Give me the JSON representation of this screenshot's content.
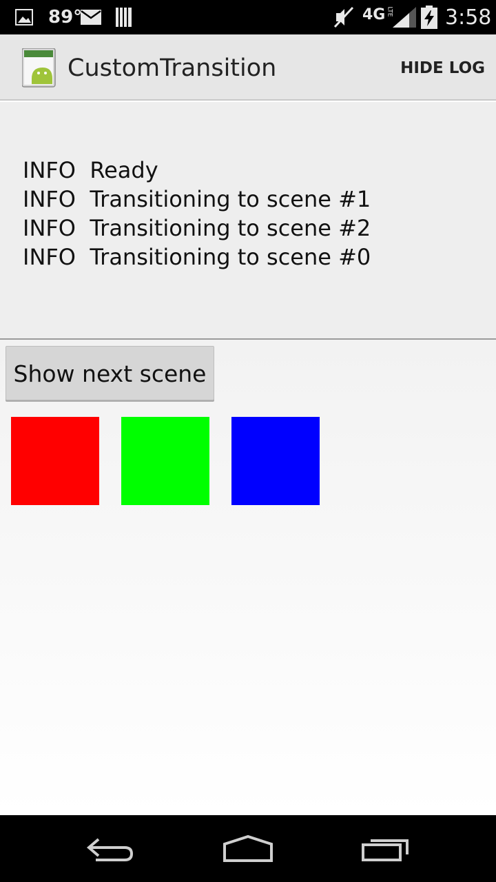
{
  "status_bar": {
    "temperature": "89°",
    "network": "4G",
    "network_sub": "LTE",
    "time": "3:58",
    "icons": [
      "image-icon",
      "mail-icon",
      "barcode-icon",
      "mute-icon",
      "signal-icon",
      "battery-charging-icon"
    ]
  },
  "action_bar": {
    "title": "CustomTransition",
    "hide_log_label": "HIDE LOG",
    "icon": "android-app-icon"
  },
  "log": {
    "entries": [
      {
        "level": "INFO",
        "message": "Ready"
      },
      {
        "level": "INFO",
        "message": "Transitioning to scene #1"
      },
      {
        "level": "INFO",
        "message": "Transitioning to scene #2"
      },
      {
        "level": "INFO",
        "message": "Transitioning to scene #0"
      }
    ]
  },
  "content": {
    "next_scene_label": "Show next scene",
    "squares": [
      {
        "name": "red-square",
        "color": "#ff0000"
      },
      {
        "name": "green-square",
        "color": "#00ff00"
      },
      {
        "name": "blue-square",
        "color": "#0000ff"
      }
    ]
  },
  "nav_bar": {
    "icons": [
      "back-icon",
      "home-icon",
      "recent-apps-icon"
    ]
  }
}
